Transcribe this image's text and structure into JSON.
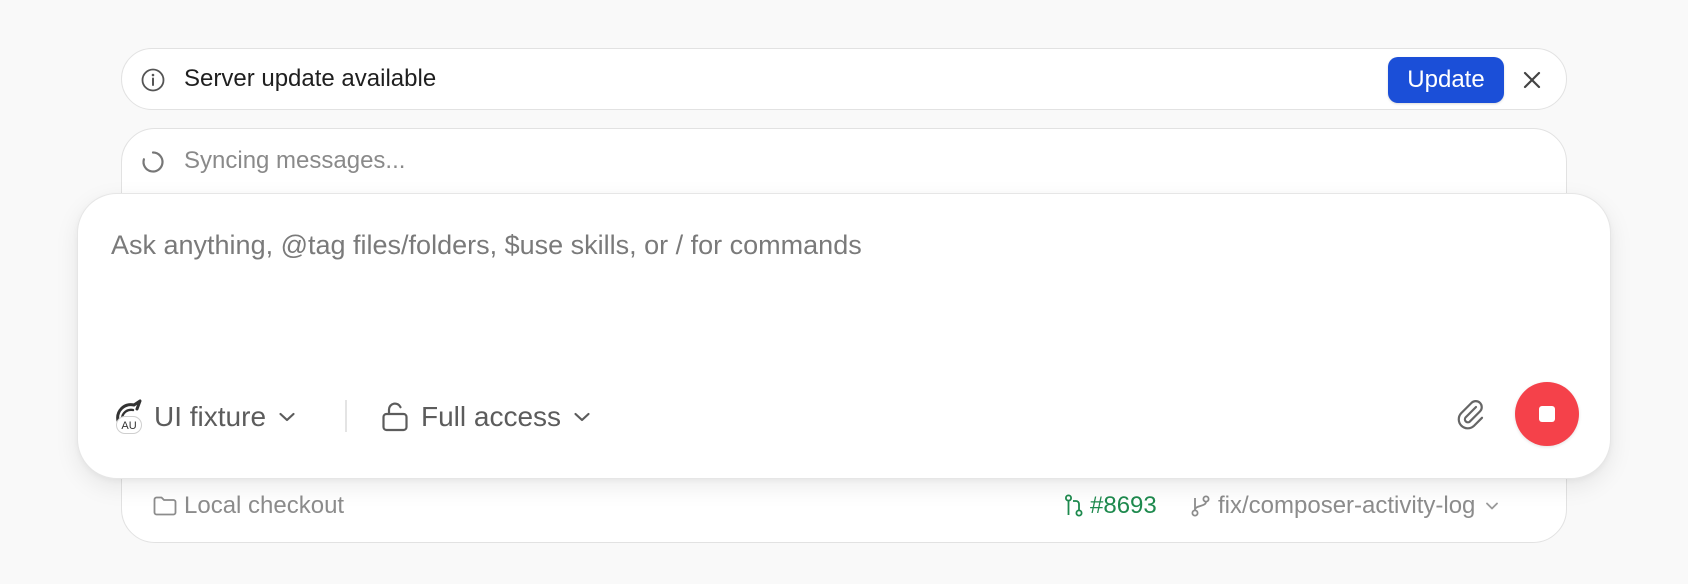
{
  "banner": {
    "icon": "info-icon",
    "title": "Server update available",
    "update_label": "Update",
    "close_icon": "close-icon",
    "accent_color": "#1b4fd8"
  },
  "sync": {
    "icon": "spinner-icon",
    "text": "Syncing messages..."
  },
  "composer": {
    "placeholder": "Ask anything, @tag files/folders, $use skills, or / for commands",
    "model": {
      "avatar_badge": "AU",
      "label": "UI fixture",
      "icon": "chevron-down-icon"
    },
    "access": {
      "icon": "unlock-icon",
      "label": "Full access"
    },
    "attach_icon": "paperclip-icon",
    "stop_icon": "stop-icon",
    "stop_color": "#f5414a"
  },
  "footer": {
    "checkout_icon": "folder-icon",
    "checkout_label": "Local checkout",
    "pr_icon": "pull-request-icon",
    "pr_label": "#8693",
    "pr_color": "#1e8a4e",
    "branch_icon": "git-branch-icon",
    "branch_label": "fix/composer-activity-log"
  }
}
